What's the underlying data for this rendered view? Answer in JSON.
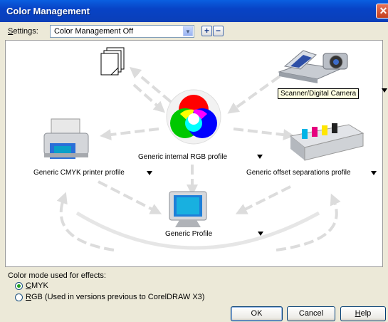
{
  "window": {
    "title": "Color Management",
    "close_glyph": "✕"
  },
  "settings": {
    "label": "Settings:",
    "label_mnemonic": "S",
    "label_rest": "ettings:",
    "selected": "Color Management Off",
    "add_glyph": "+",
    "remove_glyph": "−"
  },
  "diagram": {
    "center_label": "Generic internal RGB profile",
    "printer_label": "Generic CMYK printer profile",
    "separations_label": "Generic offset separations profile",
    "monitor_label": "Generic Profile",
    "scanner_tooltip": "Scanner/Digital Camera",
    "icons": [
      "documents-icon",
      "scanner-camera-icon",
      "rgb-color-wheel-icon",
      "printer-icon",
      "offset-press-icon",
      "monitor-icon"
    ]
  },
  "effects": {
    "label": "Color mode used for effects:",
    "cmyk": {
      "mnemonic": "C",
      "rest": "MYK",
      "checked": true
    },
    "rgb": {
      "mnemonic": "R",
      "rest": "GB (Used in versions previous to CorelDRAW X3)",
      "checked": false
    }
  },
  "buttons": {
    "ok": "OK",
    "cancel": "Cancel",
    "help_mnemonic": "H",
    "help_rest": "elp"
  },
  "colors": {
    "titlebar": "#0a4fd4",
    "dialog_bg": "#ece9d8",
    "arrow": "#dcdcdc"
  }
}
